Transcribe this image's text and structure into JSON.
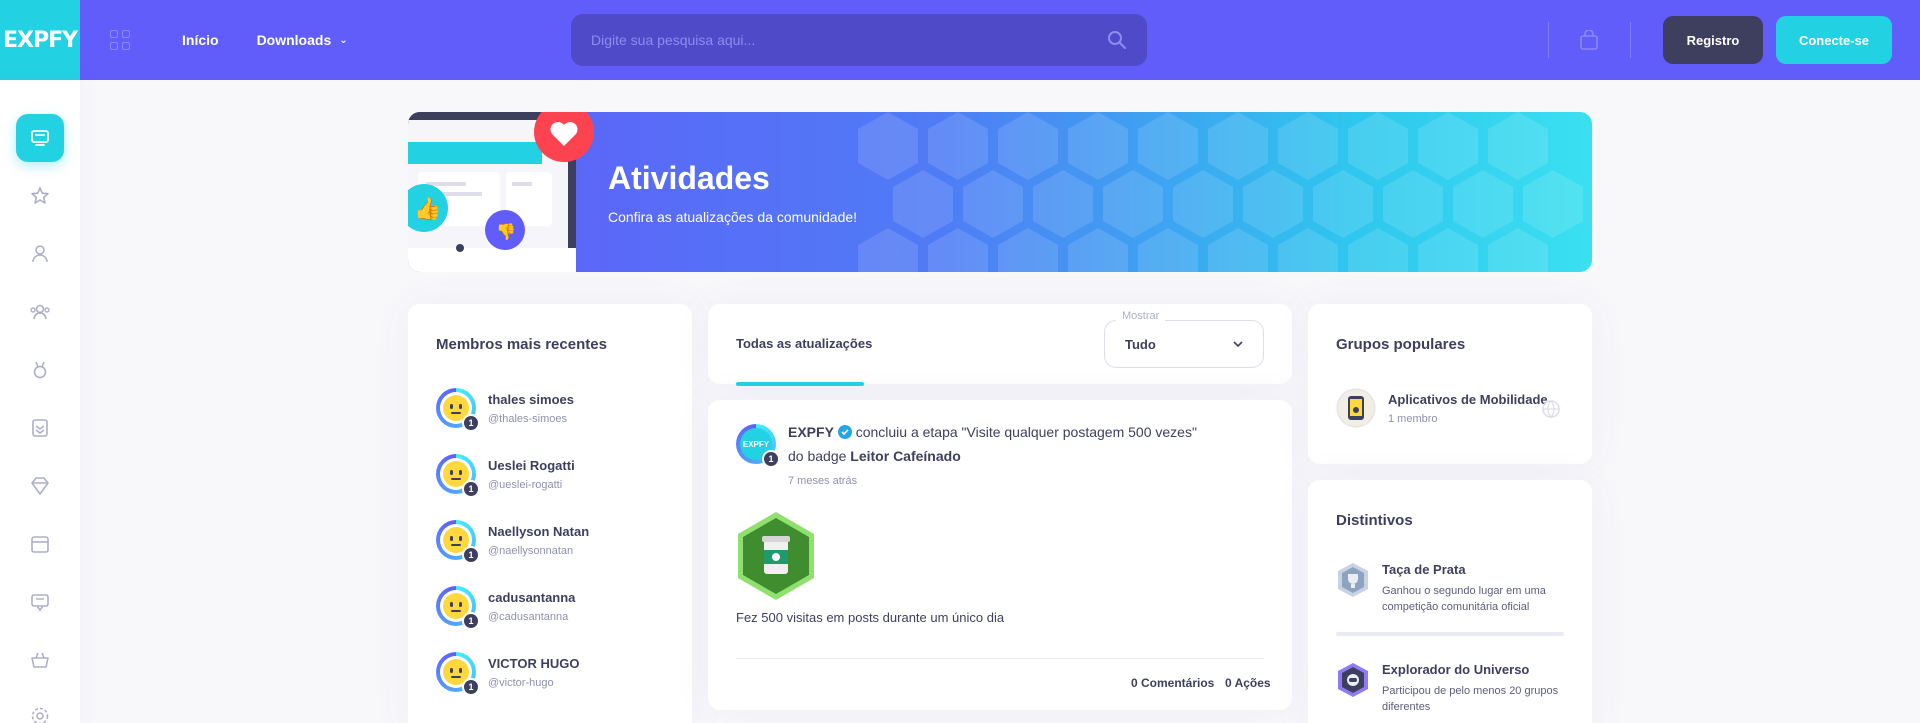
{
  "header": {
    "logo": "EXPFY",
    "nav": [
      {
        "label": "Início"
      },
      {
        "label": "Downloads"
      }
    ],
    "search_placeholder": "Digite sua pesquisa aqui...",
    "register_label": "Registro",
    "login_label": "Conecte-se"
  },
  "sidebar": {
    "items": [
      "desktop-icon",
      "star-icon",
      "user-icon",
      "friends-icon",
      "medal-icon",
      "layers-icon",
      "diamond-icon",
      "calendar-icon",
      "chat-icon",
      "basket-icon",
      "settings-icon"
    ]
  },
  "banner": {
    "title": "Atividades",
    "subtitle": "Confira as atualizações da comunidade!"
  },
  "members": {
    "title": "Membros mais recentes",
    "list": [
      {
        "name": "thales simoes",
        "handle": "@thales-simoes",
        "level": "1"
      },
      {
        "name": "Ueslei Rogatti",
        "handle": "@ueslei-rogatti",
        "level": "1"
      },
      {
        "name": "Naellyson Natan",
        "handle": "@naellysonnatan",
        "level": "1"
      },
      {
        "name": "cadusantanna",
        "handle": "@cadusantanna",
        "level": "1"
      },
      {
        "name": "VICTOR HUGO",
        "handle": "@victor-hugo",
        "level": "1"
      }
    ]
  },
  "feed": {
    "tab_label": "Todas as atualizações",
    "filter_label": "Mostrar",
    "filter_value": "Tudo",
    "post": {
      "author": "EXPFY",
      "author_level": "1",
      "action": "concluiu a etapa \"Visite qualquer postagem 500 vezes\"",
      "badge_prefix": "do badge",
      "badge_name": "Leitor Cafeínado",
      "time": "7 meses atrás",
      "description": "Fez 500 visitas em posts durante um único dia",
      "comments": "0 Comentários",
      "shares": "0 Ações"
    }
  },
  "groups": {
    "title": "Grupos populares",
    "list": [
      {
        "name": "Aplicativos de Mobilidade",
        "members": "1 membro"
      }
    ]
  },
  "badges": {
    "title": "Distintivos",
    "list": [
      {
        "name": "Taça de Prata",
        "desc": "Ganhou o segundo lugar em uma competição comunitária oficial"
      },
      {
        "name": "Explorador do Universo",
        "desc": "Participou de pelo menos 20 grupos diferentes"
      }
    ]
  },
  "colors": {
    "primary": "#615dfa",
    "accent": "#23d2e2",
    "dark": "#3e3f5e"
  }
}
